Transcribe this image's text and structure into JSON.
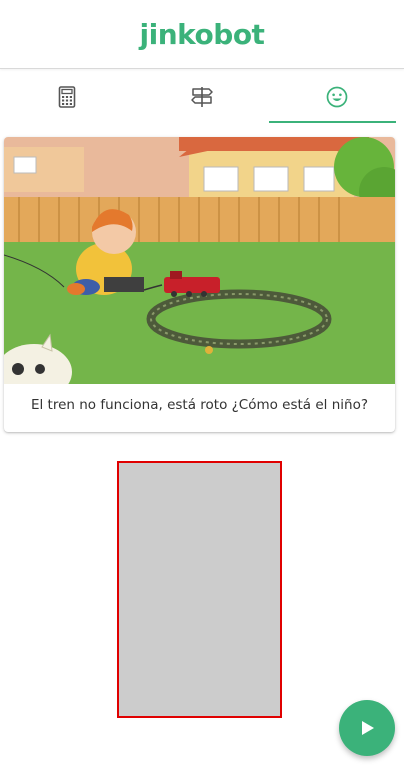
{
  "app": {
    "brand": "jinkobot",
    "accent_color": "#3bb27a"
  },
  "tabs": [
    {
      "icon": "calculator-icon",
      "active": false
    },
    {
      "icon": "signpost-icon",
      "active": false
    },
    {
      "icon": "smiley-icon",
      "active": true
    }
  ],
  "card": {
    "image": "illustration of a child sitting on grass with a toy train on an oval track in front of a house",
    "caption": "El tren no funciona, está roto ¿Cómo está el niño?"
  },
  "fab": {
    "icon": "play-icon"
  }
}
